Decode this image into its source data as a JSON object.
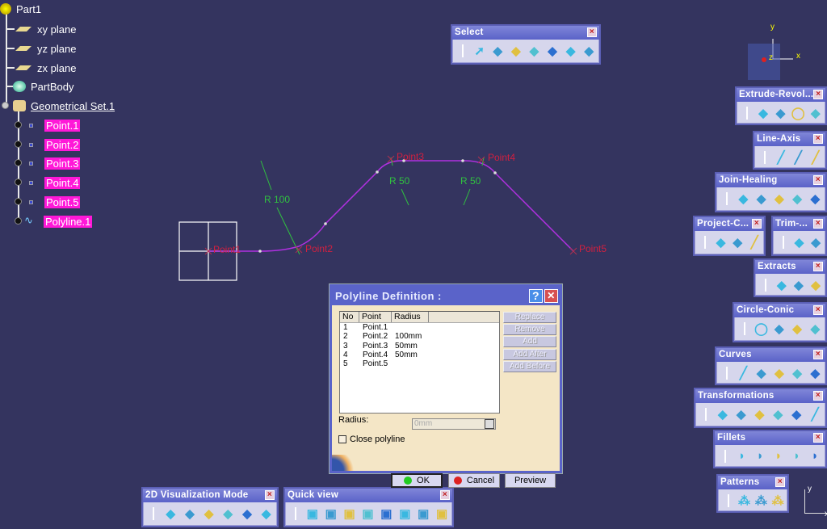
{
  "tree": {
    "root": "Part1",
    "items": [
      "xy plane",
      "yz plane",
      "zx plane",
      "PartBody"
    ],
    "set": "Geometrical Set.1",
    "children": [
      "Point.1",
      "Point.2",
      "Point.3",
      "Point.4",
      "Point.5",
      "Polyline.1"
    ]
  },
  "geometry": {
    "points": [
      "Point1",
      "Point2",
      "Point3",
      "Point4",
      "Point5"
    ],
    "radii": [
      "R 100",
      "R 50",
      "R 50"
    ]
  },
  "toolbars": [
    {
      "title": "Select",
      "icons": [
        "select-arrow-icon",
        "select-box-icon",
        "select-intersect-icon",
        "select-polygon-icon",
        "select-freehand-icon",
        "select-outside-box-icon",
        "select-outside-intersect-icon"
      ]
    },
    {
      "title": "Extrude-Revol...",
      "icons": [
        "extrude-icon",
        "revolve-icon",
        "sphere-icon",
        "cylinder-icon"
      ]
    },
    {
      "title": "Line-Axis",
      "icons": [
        "line-icon",
        "axis-icon",
        "polyline-icon"
      ]
    },
    {
      "title": "Join-Healing",
      "icons": [
        "join-icon",
        "healing-icon",
        "curve-smooth-icon",
        "untrim-icon",
        "disassemble-icon"
      ]
    },
    {
      "title": "Project-C...",
      "icons": [
        "projection-icon",
        "combine-icon",
        "reflect-line-icon"
      ]
    },
    {
      "title": "Trim-...",
      "icons": [
        "split-icon",
        "trim-icon"
      ]
    },
    {
      "title": "Extracts",
      "icons": [
        "boundary-icon",
        "extract-icon",
        "multiple-extract-icon"
      ]
    },
    {
      "title": "Circle-Conic",
      "icons": [
        "circle-icon",
        "corner-icon",
        "connect-curve-icon",
        "conic-icon"
      ]
    },
    {
      "title": "Curves",
      "icons": [
        "spline-icon",
        "helix-icon",
        "spiral-icon",
        "spine-icon",
        "isoparametric-curve-icon"
      ]
    },
    {
      "title": "Transformations",
      "icons": [
        "translate-icon",
        "rotate-icon",
        "symmetry-icon",
        "scaling-icon",
        "affinity-icon",
        "axis-to-axis-icon"
      ]
    },
    {
      "title": "Fillets",
      "icons": [
        "shape-fillet-icon",
        "edge-fillet-icon",
        "variable-fillet-icon",
        "face-fillet-icon",
        "tritangent-fillet-icon"
      ]
    },
    {
      "title": "Patterns",
      "icons": [
        "rect-pattern-icon",
        "circ-pattern-icon",
        "user-pattern-icon"
      ]
    },
    {
      "title": "2D Visualization Mode",
      "icons": [
        "pickable-icon",
        "no-pick-icon",
        "pickable-low-light-icon",
        "no-3d-icon",
        "low-light-icon",
        "options-icon"
      ]
    },
    {
      "title": "Quick view",
      "icons": [
        "isometric-view-icon",
        "front-view-icon",
        "back-view-icon",
        "left-view-icon",
        "right-view-icon",
        "top-view-icon",
        "bottom-view-icon",
        "named-views-icon"
      ]
    }
  ],
  "dialog": {
    "title": "Polyline Definition :",
    "help": "?",
    "close": "✕",
    "columns": [
      "No",
      "Point",
      "Radius"
    ],
    "rows": [
      [
        "1",
        "Point.1",
        ""
      ],
      [
        "2",
        "Point.2",
        "100mm"
      ],
      [
        "3",
        "Point.3",
        "50mm"
      ],
      [
        "4",
        "Point.4",
        "50mm"
      ],
      [
        "5",
        "Point.5",
        ""
      ]
    ],
    "side_buttons": [
      "Replace",
      "Remove",
      "Add",
      "Add After",
      "Add Before"
    ],
    "radius_label": "Radius:",
    "radius_value": "0mm",
    "close_polyline": "Close polyline",
    "close_polyline_checked": false,
    "ok": "OK",
    "cancel": "Cancel",
    "preview": "Preview"
  },
  "compass": {
    "x": "x",
    "y": "y",
    "z": "z"
  },
  "axis": {
    "x": "x",
    "y": "y"
  },
  "colors": {
    "background": "#34345f",
    "highlight": "#ff18d8",
    "curve": "#b030e0",
    "label": "#d02040",
    "dimension": "#30c040"
  }
}
